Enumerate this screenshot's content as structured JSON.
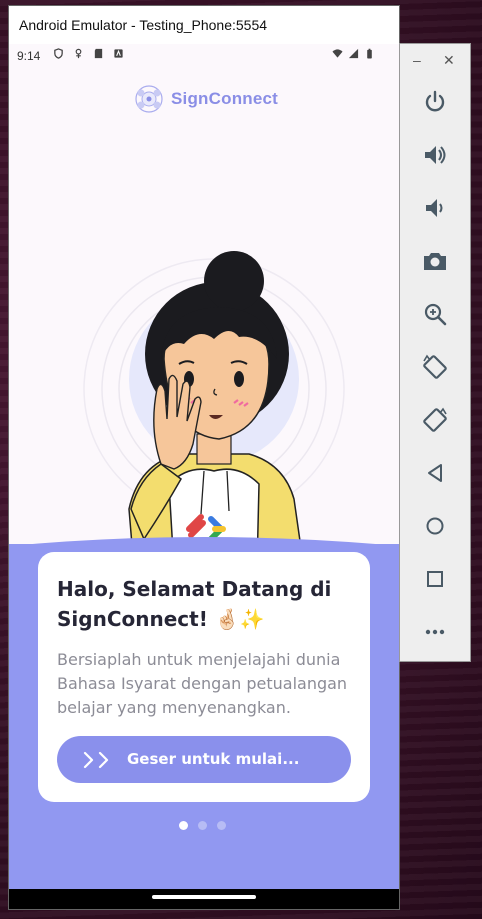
{
  "window": {
    "title": "Android Emulator - Testing_Phone:5554"
  },
  "status_bar": {
    "time": "9:14",
    "left_icons": [
      "shield-icon",
      "usb-debug-icon",
      "sd-card-icon",
      "app-notification-icon"
    ],
    "right_icons": [
      "wifi-icon",
      "signal-icon",
      "battery-icon"
    ]
  },
  "app": {
    "logo_text": "SignConnect",
    "card": {
      "title_line1": "Halo, Selamat Datang di",
      "title_line2": "SignConnect! 🤞🏻✨",
      "description": "Bersiaplah untuk menjelajahi dunia Bahasa Isyarat dengan petualangan belajar yang menyenangkan.",
      "swipe_label": "Geser untuk mulai..."
    },
    "page_indicator": {
      "total": 3,
      "active": 1
    }
  },
  "toolbar": {
    "minimize": "–",
    "close": "✕",
    "buttons": [
      "power-icon",
      "volume-up-icon",
      "volume-down-icon",
      "camera-icon",
      "zoom-icon",
      "rotate-left-icon",
      "rotate-right-icon",
      "back-icon",
      "home-icon",
      "overview-icon",
      "more-icon"
    ]
  },
  "colors": {
    "accent": "#8a90ec",
    "purple_bg": "#9198f1",
    "logo": "#8a8ee6",
    "card_title": "#262636",
    "card_text": "#8c8c96"
  }
}
